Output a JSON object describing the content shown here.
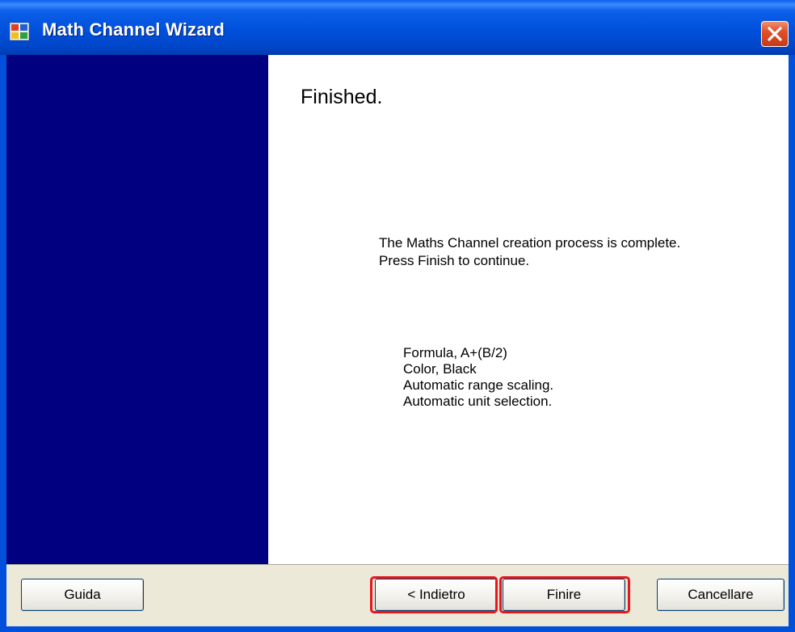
{
  "window": {
    "title": "Math Channel Wizard"
  },
  "page": {
    "heading": "Finished.",
    "message": "The Maths Channel creation process is complete. Press Finish to continue.",
    "summary": [
      "Formula, A+(B/2)",
      "Color, Black",
      "Automatic range scaling.",
      "Automatic unit selection."
    ]
  },
  "buttons": {
    "help": "Guida",
    "back": "< Indietro",
    "finish": "Finire",
    "cancel": "Cancellare"
  },
  "colors": {
    "side_panel": "#000080",
    "title_bar": "#0054e3",
    "highlight": "#e8161a"
  },
  "icons": [
    "app-icon",
    "close-icon"
  ]
}
